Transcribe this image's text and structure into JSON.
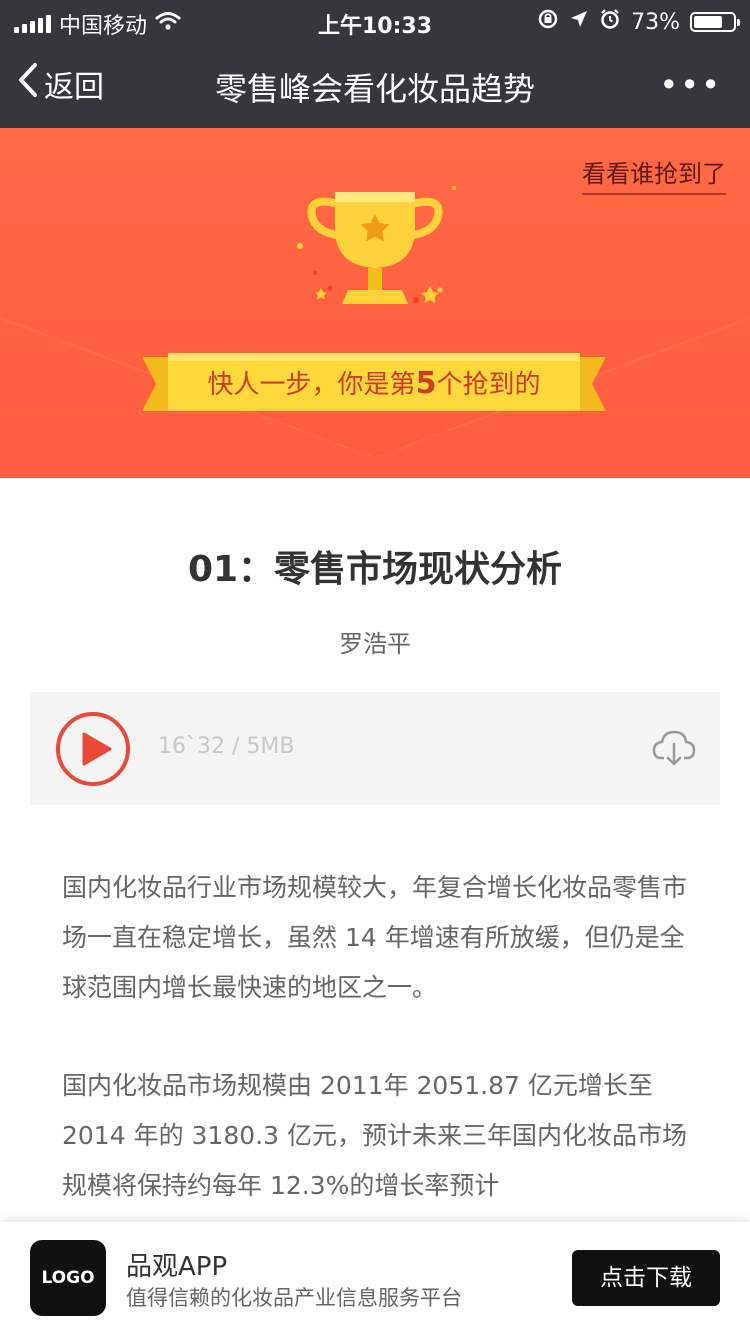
{
  "status_bar": {
    "carrier": "中国移动",
    "time": "上午10:33",
    "battery_percent": "73%",
    "battery_level": 0.73
  },
  "nav": {
    "back_label": "返回",
    "title": "零售峰会看化妆品趋势",
    "more_label": "•••"
  },
  "banner": {
    "who_grabbed_link": "看看谁抢到了",
    "ribbon_prefix": "快人一步，你是第",
    "ribbon_rank": "5",
    "ribbon_suffix": "个抢到的"
  },
  "article": {
    "title": "01：零售市场现状分析",
    "author": "罗浩平",
    "audio_meta": "16`32 / 5MB",
    "paragraphs": [
      "国内化妆品行业市场规模较大，年复合增长化妆品零售市场一直在稳定增长，虽然 14 年增速有所放缓，但仍是全球范围内增长最快速的地区之一。",
      "国内化妆品市场规模由 2011年 2051.87 亿元增长至 2014 年的 3180.3 亿元，预计未来三年国内化妆品市场规模将保持约每年 12.3%的增长率预计"
    ]
  },
  "footer": {
    "logo_text": "LOGO",
    "app_name": "品观APP",
    "app_desc": "值得信赖的化妆品产业信息服务平台",
    "download_label": "点击下载"
  },
  "colors": {
    "nav_bg": "#36373b",
    "banner_bg": "#ff5a3e",
    "ribbon": "#ffd23b",
    "play_red": "#e84a3a"
  }
}
